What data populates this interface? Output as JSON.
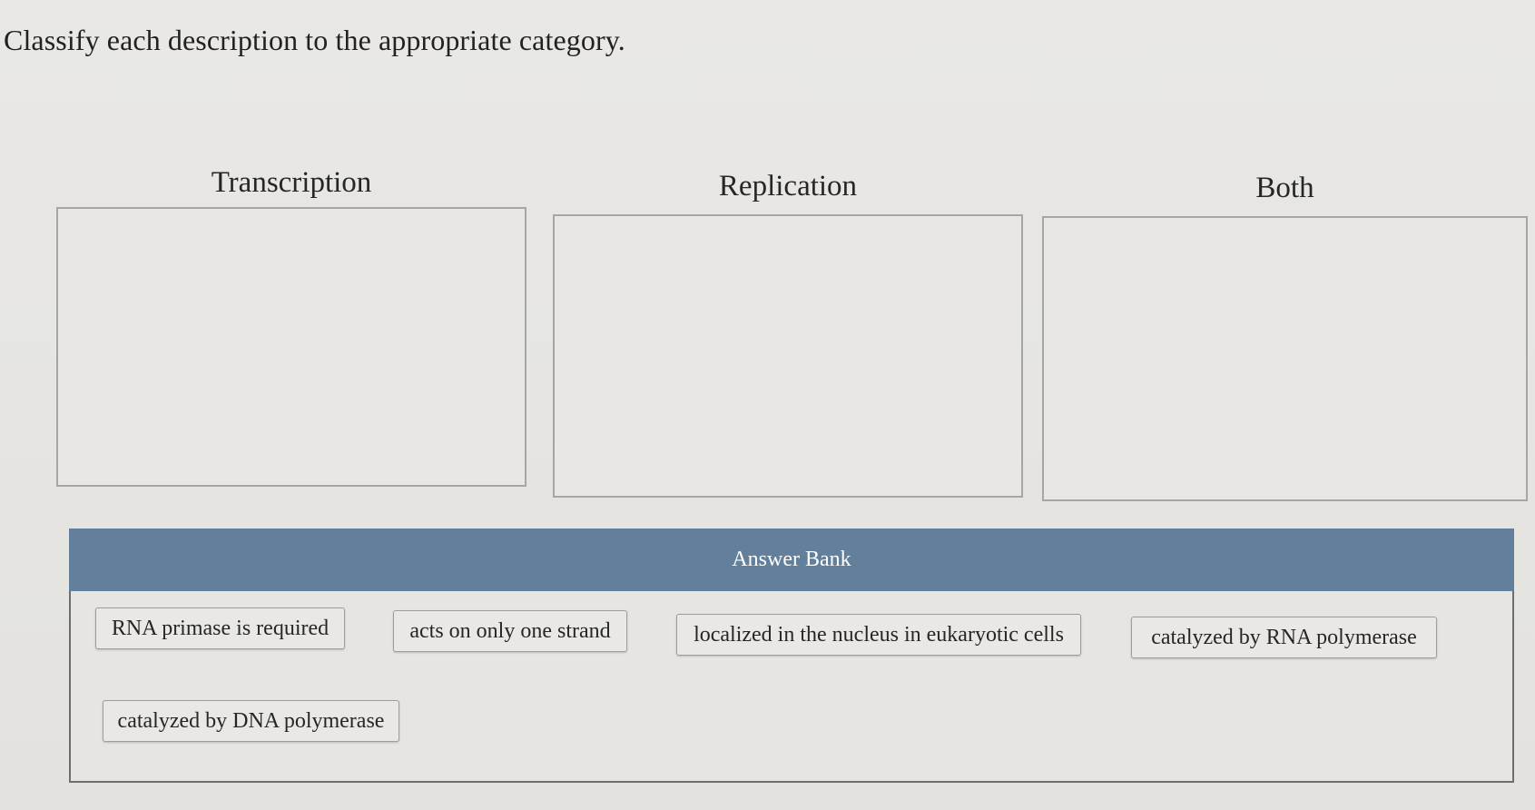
{
  "prompt": "Classify each description to the appropriate category.",
  "categories": [
    {
      "title": "Transcription"
    },
    {
      "title": "Replication"
    },
    {
      "title": "Both"
    }
  ],
  "answer_bank": {
    "title": "Answer Bank",
    "items": [
      "RNA primase is required",
      "acts on only one strand",
      "localized in the nucleus in eukaryotic cells",
      "catalyzed by RNA polymerase",
      "catalyzed by DNA polymerase"
    ]
  }
}
